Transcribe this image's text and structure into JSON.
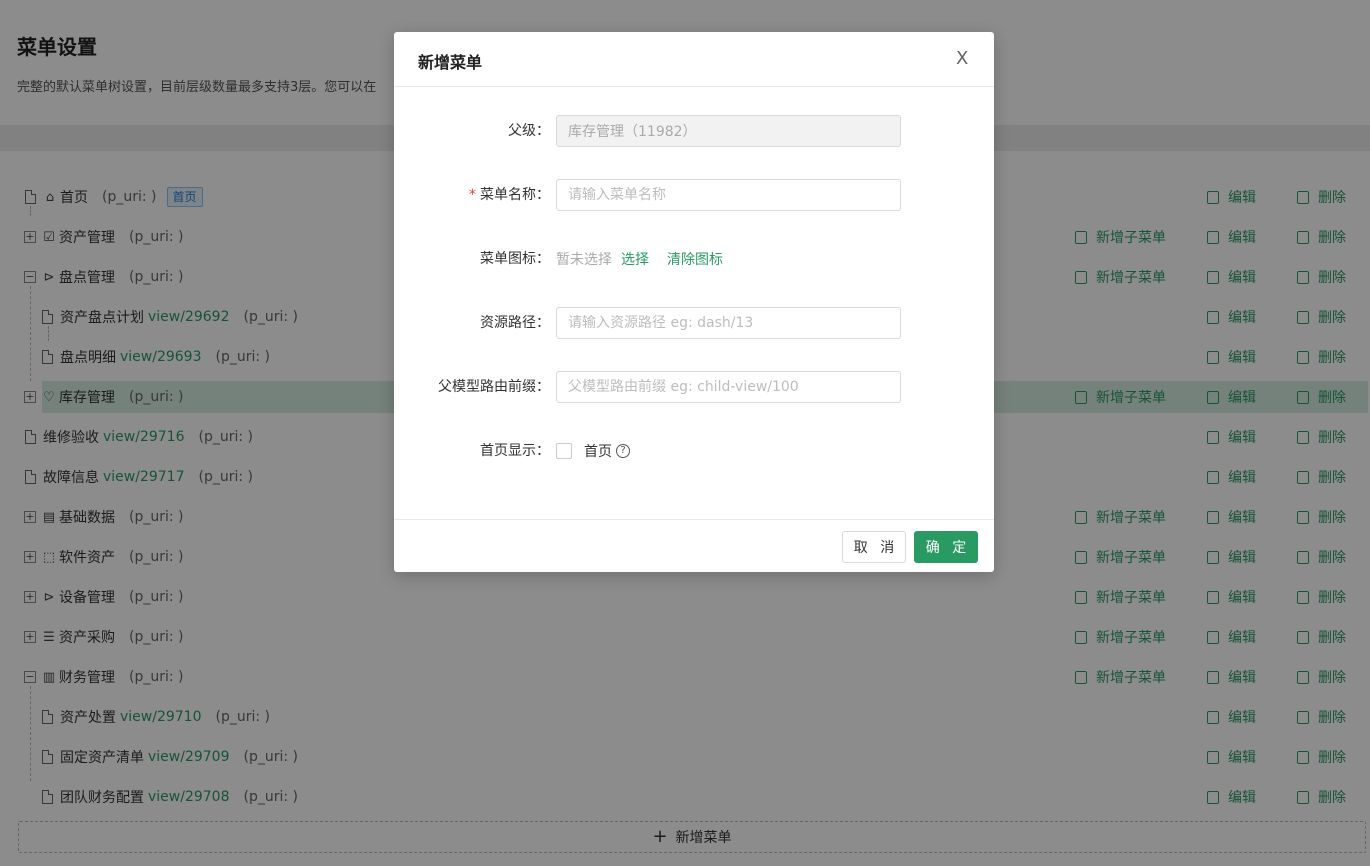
{
  "page": {
    "title": "菜单设置",
    "description": "完整的默认菜单树设置，目前层级数量最多支持3层。您可以在"
  },
  "actions": {
    "add_child": "新增子菜单",
    "edit": "编辑",
    "delete": "删除"
  },
  "tree": {
    "rows": [
      {
        "label": "首页",
        "link": "",
        "puri": "(p_uri: )",
        "tag": "首页"
      },
      {
        "label": "资产管理",
        "link": "",
        "puri": "(p_uri: )"
      },
      {
        "label": "盘点管理",
        "link": "",
        "puri": "(p_uri: )"
      },
      {
        "label": "资产盘点计划",
        "link": "view/29692",
        "puri": "(p_uri: )"
      },
      {
        "label": "盘点明细",
        "link": "view/29693",
        "puri": "(p_uri: )"
      },
      {
        "label": "库存管理",
        "link": "",
        "puri": "(p_uri: )"
      },
      {
        "label": "维修验收",
        "link": "view/29716",
        "puri": "(p_uri: )"
      },
      {
        "label": "故障信息",
        "link": "view/29717",
        "puri": "(p_uri: )"
      },
      {
        "label": "基础数据",
        "link": "",
        "puri": "(p_uri: )"
      },
      {
        "label": "软件资产",
        "link": "",
        "puri": "(p_uri: )"
      },
      {
        "label": "设备管理",
        "link": "",
        "puri": "(p_uri: )"
      },
      {
        "label": "资产采购",
        "link": "",
        "puri": "(p_uri: )"
      },
      {
        "label": "财务管理",
        "link": "",
        "puri": "(p_uri: )"
      },
      {
        "label": "资产处置",
        "link": "view/29710",
        "puri": "(p_uri: )"
      },
      {
        "label": "固定资产清单",
        "link": "view/29709",
        "puri": "(p_uri: )"
      },
      {
        "label": "团队财务配置",
        "link": "view/29708",
        "puri": "(p_uri: )"
      }
    ],
    "add_menu_label": "新增菜单"
  },
  "modal": {
    "title": "新增菜单",
    "close": "X",
    "parent_label": "父级",
    "parent_value": "库存管理（11982）",
    "name_label": "菜单名称",
    "name_placeholder": "请输入菜单名称",
    "icon_label": "菜单图标",
    "icon_status": "暂未选择",
    "icon_select": "选择",
    "icon_clear": "清除图标",
    "path_label": "资源路径",
    "path_placeholder": "请输入资源路径 eg: dash/13",
    "prefix_label": "父模型路由前缀",
    "prefix_placeholder": "父模型路由前缀 eg: child-view/100",
    "home_label": "首页显示",
    "home_option": "首页",
    "cancel": "取 消",
    "ok": "确 定"
  },
  "icons": [
    "file-icon",
    "home-icon",
    "check-square-icon",
    "shop-icon",
    "database-icon",
    "dashed-square-icon",
    "server-icon",
    "barcode-icon",
    "edit-icon",
    "trash-icon",
    "file-add-icon",
    "question-icon",
    "plus-icon",
    "close-icon"
  ],
  "colors": {
    "accent": "#2a9a63",
    "tag": "#1e7fc9",
    "selected_row": "#d6ece0"
  }
}
